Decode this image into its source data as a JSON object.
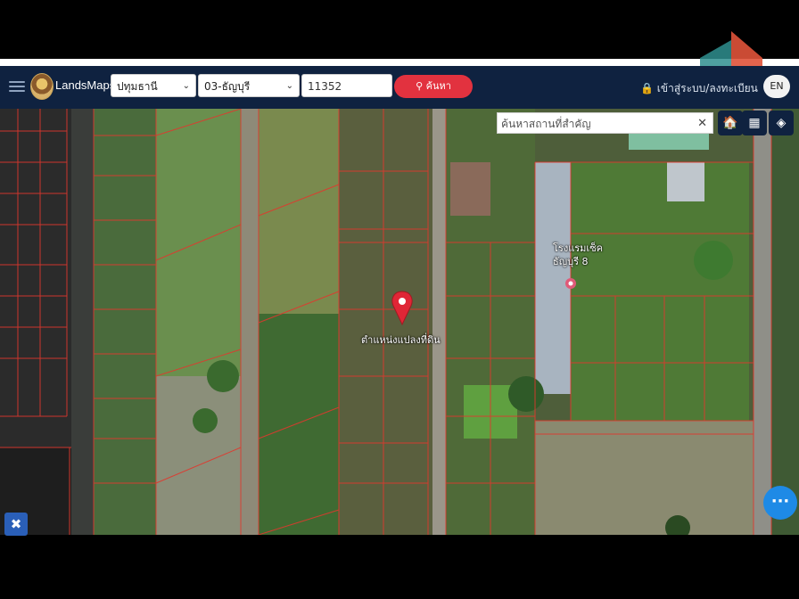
{
  "brand": "LandsMaps",
  "province_select": "ปทุมธานี",
  "district_select": "03-ธัญบุรี",
  "parcel_input": "11352",
  "search_button": "ค้นหา",
  "login_label": "เข้าสู่ระบบ/ลงทะเบียน",
  "lang_button": "EN",
  "place_search_placeholder": "ค้นหาสถานที่สำคัญ",
  "map_labels": {
    "parcel_marker": "ตำแหน่งแปลงที่ดิน",
    "poi_line1": "โรงแรมเซ็ค",
    "poi_line2": "ธัญบุรี 8"
  },
  "icons": {
    "menu": "hamburger-icon",
    "search": "search-icon",
    "clear": "close-icon",
    "poi": "building-icon",
    "grid": "grid-icon",
    "layers": "layers-icon",
    "more": "more-icon",
    "tools": "tools-icon",
    "user": "user-icon"
  },
  "colors": {
    "navbar": "#0f2240",
    "search_button": "#e2323f",
    "parcel_lines": "#e0382e",
    "fab": "#1e8ae6"
  }
}
